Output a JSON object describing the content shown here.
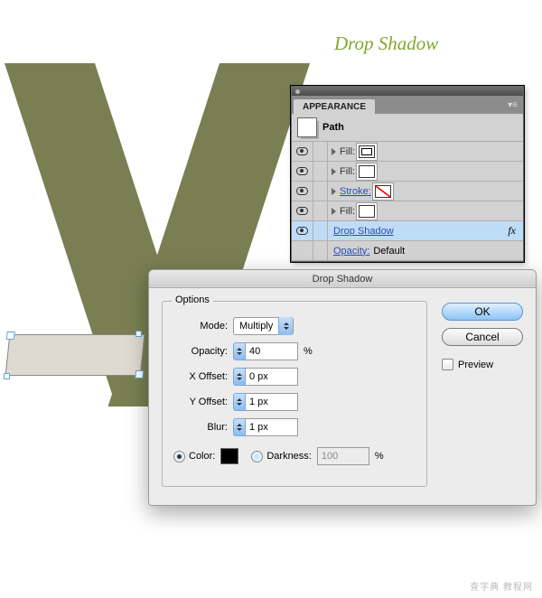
{
  "title": "Drop Shadow",
  "appearance": {
    "tab": "APPEARANCE",
    "object": "Path",
    "rows": [
      {
        "label": "Fill:",
        "swatch": "dbl"
      },
      {
        "label": "Fill:",
        "swatch": "white"
      },
      {
        "label": "Stroke:",
        "swatch": "none",
        "link": true
      },
      {
        "label": "Fill:",
        "swatch": "white"
      }
    ],
    "effect": {
      "label": "Drop Shadow",
      "fx": "fx"
    },
    "opacity": {
      "label": "Opacity:",
      "value": "Default"
    }
  },
  "dialog": {
    "title": "Drop Shadow",
    "group": "Options",
    "mode": {
      "label": "Mode:",
      "value": "Multiply"
    },
    "opacity": {
      "label": "Opacity:",
      "value": "40",
      "unit": "%"
    },
    "xoffset": {
      "label": "X Offset:",
      "value": "0 px"
    },
    "yoffset": {
      "label": "Y Offset:",
      "value": "1 px"
    },
    "blur": {
      "label": "Blur:",
      "value": "1 px"
    },
    "color": {
      "label": "Color:",
      "swatch": "#000000"
    },
    "darkness": {
      "label": "Darkness:",
      "value": "100",
      "unit": "%"
    },
    "ok": "OK",
    "cancel": "Cancel",
    "preview": "Preview"
  },
  "watermark": "查字典 教程网"
}
